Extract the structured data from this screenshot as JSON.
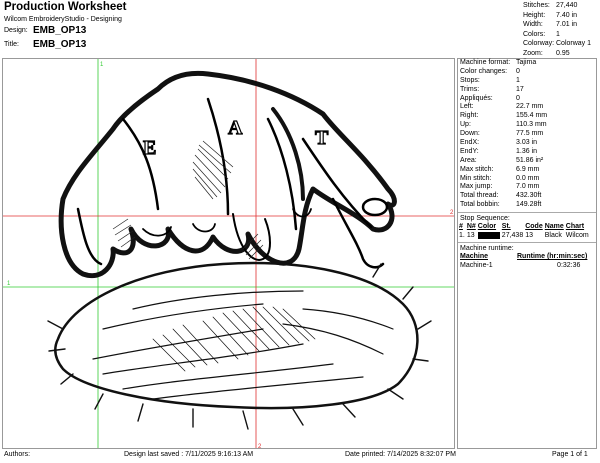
{
  "header": {
    "title": "Production Worksheet",
    "studio": "Wilcom EmbroideryStudio - Designing",
    "design_label": "Design:",
    "design_value": "EMB_OP13",
    "title_label": "Title:",
    "title_value": "EMB_OP13"
  },
  "stats": [
    {
      "k": "Stitches:",
      "v": "27,440"
    },
    {
      "k": "Height:",
      "v": "7.40 in"
    },
    {
      "k": "Width:",
      "v": "7.01 in"
    },
    {
      "k": "Colors:",
      "v": "1"
    },
    {
      "k": "Colorway:",
      "v": "Colorway 1"
    },
    {
      "k": "Zoom:",
      "v": "0.95"
    }
  ],
  "info": [
    {
      "k": "Machine format:",
      "v": "Tajima"
    },
    {
      "k": "Color changes:",
      "v": "0"
    },
    {
      "k": "Stops:",
      "v": "1"
    },
    {
      "k": "Trims:",
      "v": "17"
    },
    {
      "k": "Appliqués:",
      "v": "0"
    },
    {
      "k": "Left:",
      "v": "22.7 mm"
    },
    {
      "k": "Right:",
      "v": "155.4 mm"
    },
    {
      "k": "Up:",
      "v": "110.3 mm"
    },
    {
      "k": "Down:",
      "v": "77.5 mm"
    },
    {
      "k": "EndX:",
      "v": "3.03 in"
    },
    {
      "k": "EndY:",
      "v": "1.36 in"
    },
    {
      "k": "Area:",
      "v": "51.86 in²"
    },
    {
      "k": "Max stitch:",
      "v": "6.9 mm"
    },
    {
      "k": "Min stitch:",
      "v": "0.0 mm"
    },
    {
      "k": "Max jump:",
      "v": "7.0 mm"
    },
    {
      "k": "Total thread:",
      "v": "432.30ft"
    },
    {
      "k": "Total bobbin:",
      "v": "149.28ft"
    }
  ],
  "stop_sequence": {
    "title": "Stop Sequence:",
    "headers": [
      "#",
      "N#",
      "Color",
      "St.",
      "Code",
      "Name",
      "Chart"
    ],
    "rows": [
      {
        "num": "1.",
        "n": "13",
        "swatch": "#000000",
        "st": "27,438",
        "code": "13",
        "name": "Black",
        "chart": "Wilcom"
      }
    ]
  },
  "runtime": {
    "title": "Machine runtime:",
    "headers": [
      "Machine",
      "Runtime (hr:min:sec)"
    ],
    "rows": [
      {
        "machine": "Machine-1",
        "time": "0:32:36"
      }
    ]
  },
  "canvas": {
    "marker_1": "1",
    "marker_2": "2",
    "letters": [
      "E",
      "A",
      "T"
    ]
  },
  "footer": {
    "authors": "Authors:",
    "saved": "Design last saved : 7/11/2025 9:16:13 AM",
    "printed": "Date printed: 7/14/2025 8:32:07 PM",
    "page": "Page 1 of 1"
  }
}
